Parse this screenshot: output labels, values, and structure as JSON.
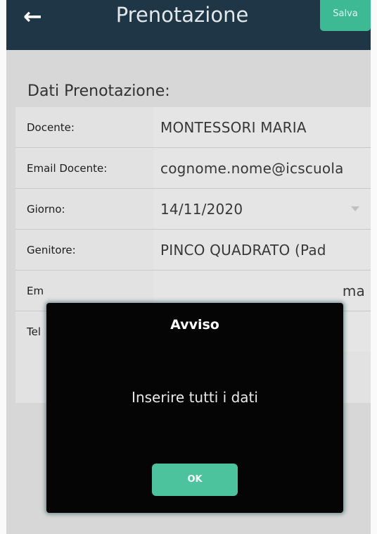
{
  "header": {
    "back_icon": "arrow-left-icon",
    "title": "Prenotazione",
    "save_label": "Salva"
  },
  "section": {
    "title": "Dati Prenotazione:"
  },
  "form": {
    "rows": [
      {
        "label": "Docente:",
        "value": "MONTESSORI MARIA"
      },
      {
        "label": "Email Docente:",
        "value": "cognome.nome@icscuola"
      },
      {
        "label": "Giorno:",
        "value": "14/11/2020"
      },
      {
        "label": "Genitore:",
        "value": "PINCO QUADRATO (Pad"
      },
      {
        "label": "Em",
        "value": "ma"
      },
      {
        "label": "Tel",
        "value": ""
      }
    ]
  },
  "dialog": {
    "title": "Avviso",
    "message": "Inserire tutti i dati",
    "ok_label": "OK"
  },
  "colors": {
    "appbar": "#203848",
    "accent": "#3fbd96",
    "dialog_bg": "#050505"
  }
}
